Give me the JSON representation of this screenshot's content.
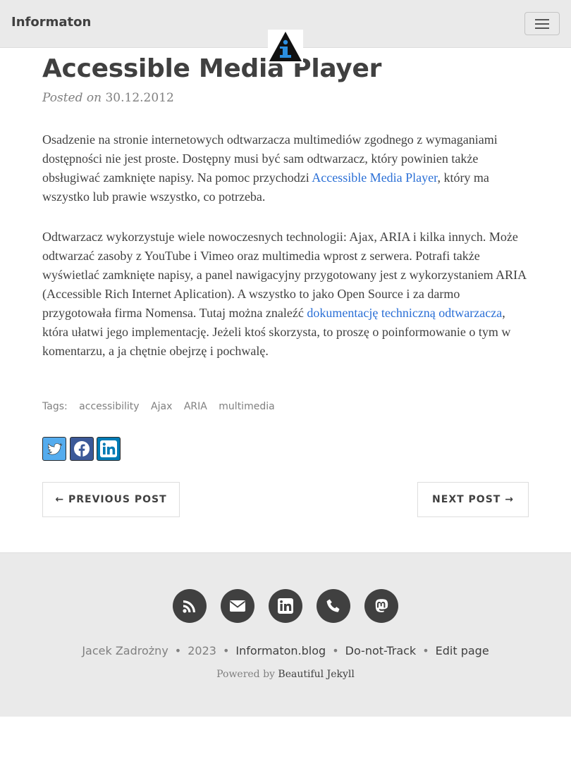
{
  "navbar": {
    "brand": "Informaton",
    "toggle_label": "Toggle navigation"
  },
  "post": {
    "title": "Accessible Media Player",
    "posted_on": "Posted on",
    "date": "30.12.2012",
    "paragraph1": {
      "before": "Osadzenie na stronie internetowych odtwarzacza multimediów zgodnego z wymaganiami dostępności nie jest proste. Dostępny musi być sam odtwarzacz, który powinien także obsługiwać zamknięte napisy. Na pomoc przychodzi ",
      "link": "Accessible Media Player",
      "after": ", który ma wszystko lub prawie wszystko, co potrzeba."
    },
    "paragraph2": {
      "before": "Odtwarzacz wykorzystuje wiele nowoczesnych technologii: Ajax, ARIA i kilka innych. Może odtwarzać zasoby z YouTube i Vimeo oraz multimedia wprost z serwera. Potrafi także wyświetlać zamknięte napisy, a panel nawigacyjny przygotowany jest z wykorzystaniem ARIA (Accessible Rich Internet Aplication). A wszystko to jako Open Source i za darmo przygotowała firma Nomensa. Tutaj można znaleźć ",
      "link": "dokumentację techniczną odtwarzacza",
      "after": ", która ułatwi jego implementację. Jeżeli ktoś skorzysta, to proszę o poinformowanie o tym w komentarzu, a ja chętnie obejrzę i pochwalę."
    },
    "tags_label": "Tags:",
    "tags": [
      "accessibility",
      "Ajax",
      "ARIA",
      "multimedia"
    ]
  },
  "share": {
    "icons": [
      "twitter-icon",
      "facebook-icon",
      "linkedin-icon"
    ],
    "colors": {
      "twitter": "#55acee",
      "facebook": "#3b5998",
      "linkedin": "#007bb5"
    }
  },
  "pager": {
    "previous": "← Previous Post",
    "next": "Next Post →"
  },
  "footer": {
    "social_icons": [
      "rss-icon",
      "email-icon",
      "linkedin-icon",
      "phone-icon",
      "mastodon-icon"
    ],
    "author": "Jacek Zadrożny",
    "year": "2023",
    "site": "Informaton.blog",
    "dnt": "Do-not-Track",
    "edit": "Edit page",
    "sep": "•",
    "powered_by": "Powered by",
    "powered_link": "Beautiful Jekyll"
  }
}
